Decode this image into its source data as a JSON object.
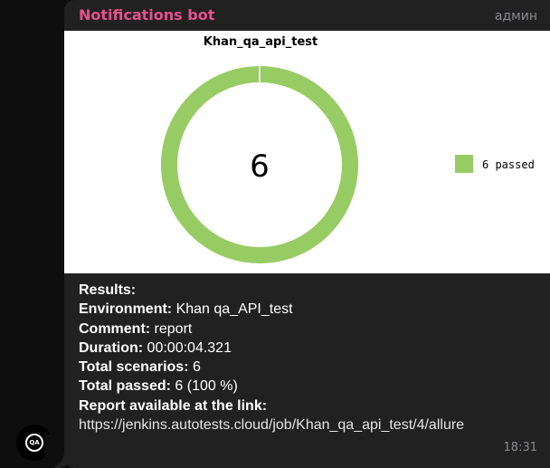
{
  "message": {
    "sender": "Notifications bot",
    "badge": "админ",
    "time": "18:31",
    "avatar_text": "QA"
  },
  "chart_data": {
    "type": "pie",
    "title": "Khan_qa_api_test",
    "center_label": "6",
    "slices": [
      {
        "label": "6 passed",
        "value": 6,
        "color": "#97cc64"
      }
    ]
  },
  "results": {
    "heading": "Results:",
    "environment_label": "Environment:",
    "environment_value": " Khan qa_API_test",
    "comment_label": "Comment:",
    "comment_value": " report",
    "duration_label": "Duration:",
    "duration_value": " 00:00:04.321",
    "total_scenarios_label": "Total scenarios:",
    "total_scenarios_value": " 6",
    "total_passed_label": "Total passed:",
    "total_passed_value": " 6 (100 %)",
    "report_label": "Report available at the link:",
    "report_link": "https://jenkins.autotests.cloud/job/Khan_qa_api_test/4/allure"
  }
}
